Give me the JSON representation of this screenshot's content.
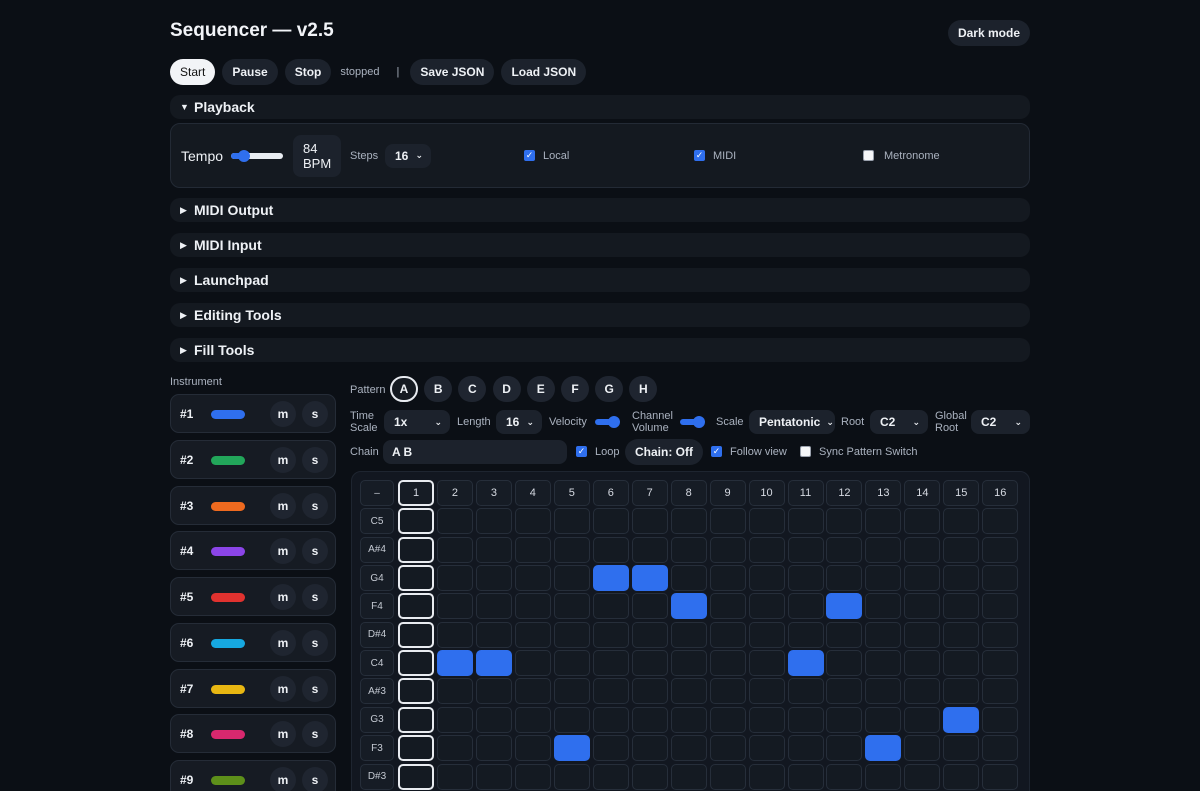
{
  "app": {
    "title": "Sequencer — v2.5",
    "dark_mode_label": "Dark mode"
  },
  "toolbar": {
    "start": "Start",
    "pause": "Pause",
    "stop": "Stop",
    "status": "stopped",
    "separator": "|",
    "save": "Save JSON",
    "load": "Load JSON"
  },
  "sections": {
    "playback": "Playback",
    "collapsed": [
      "MIDI Output",
      "MIDI Input",
      "Launchpad",
      "Editing Tools",
      "Fill Tools"
    ]
  },
  "playback": {
    "tempo_label": "Tempo",
    "tempo_slider_level": 0.25,
    "bpm_value": "84",
    "bpm_unit": "BPM",
    "steps_label": "Steps",
    "steps_value": "16",
    "local_label": "Local",
    "local_checked": true,
    "midi_label": "MIDI",
    "midi_checked": true,
    "metronome_label": "Metronome",
    "metronome_checked": false
  },
  "instruments": {
    "heading": "Instrument",
    "mute_label": "m",
    "solo_label": "s",
    "items": [
      {
        "label": "#1",
        "color": "#2f6fee"
      },
      {
        "label": "#2",
        "color": "#22a65a"
      },
      {
        "label": "#3",
        "color": "#ee6a1f"
      },
      {
        "label": "#4",
        "color": "#8b45e8"
      },
      {
        "label": "#5",
        "color": "#e0322f"
      },
      {
        "label": "#6",
        "color": "#16a8e0"
      },
      {
        "label": "#7",
        "color": "#e8b712"
      },
      {
        "label": "#8",
        "color": "#d8286e"
      },
      {
        "label": "#9",
        "color": "#5d8f1a"
      }
    ]
  },
  "editor": {
    "pattern_label": "Pattern",
    "patterns": [
      "A",
      "B",
      "C",
      "D",
      "E",
      "F",
      "G",
      "H"
    ],
    "active_pattern": "A",
    "time_scale_label_1": "Time",
    "time_scale_label_2": "Scale",
    "time_scale_value": "1x",
    "length_label": "Length",
    "length_value": "16",
    "velocity_label": "Velocity",
    "velocity_level": 0.85,
    "channel_volume_label_1": "Channel",
    "channel_volume_label_2": "Volume",
    "channel_volume_level": 0.85,
    "scale_label": "Scale",
    "scale_value": "Pentatonic",
    "root_label": "Root",
    "root_value": "C2",
    "global_root_label_1": "Global",
    "global_root_label_2": "Root",
    "global_root_value": "C2",
    "chain_label": "Chain",
    "chain_value": "A B",
    "loop_label": "Loop",
    "loop_checked": true,
    "chain_status": "Chain: Off",
    "follow_view_label": "Follow view",
    "follow_view_checked": true,
    "sync_label": "Sync Pattern Switch",
    "sync_checked": false
  },
  "grid": {
    "corner": "–",
    "steps": [
      "1",
      "2",
      "3",
      "4",
      "5",
      "6",
      "7",
      "8",
      "9",
      "10",
      "11",
      "12",
      "13",
      "14",
      "15",
      "16"
    ],
    "playhead_step": 1,
    "rows": [
      {
        "note": "C5",
        "active": []
      },
      {
        "note": "A#4",
        "active": []
      },
      {
        "note": "G4",
        "active": [
          6,
          7
        ]
      },
      {
        "note": "F4",
        "active": [
          8,
          12
        ]
      },
      {
        "note": "D#4",
        "active": []
      },
      {
        "note": "C4",
        "active": [
          2,
          3,
          11
        ]
      },
      {
        "note": "A#3",
        "active": []
      },
      {
        "note": "G3",
        "active": [
          15
        ]
      },
      {
        "note": "F3",
        "active": [
          5,
          13
        ]
      },
      {
        "note": "D#3",
        "active": []
      }
    ]
  }
}
